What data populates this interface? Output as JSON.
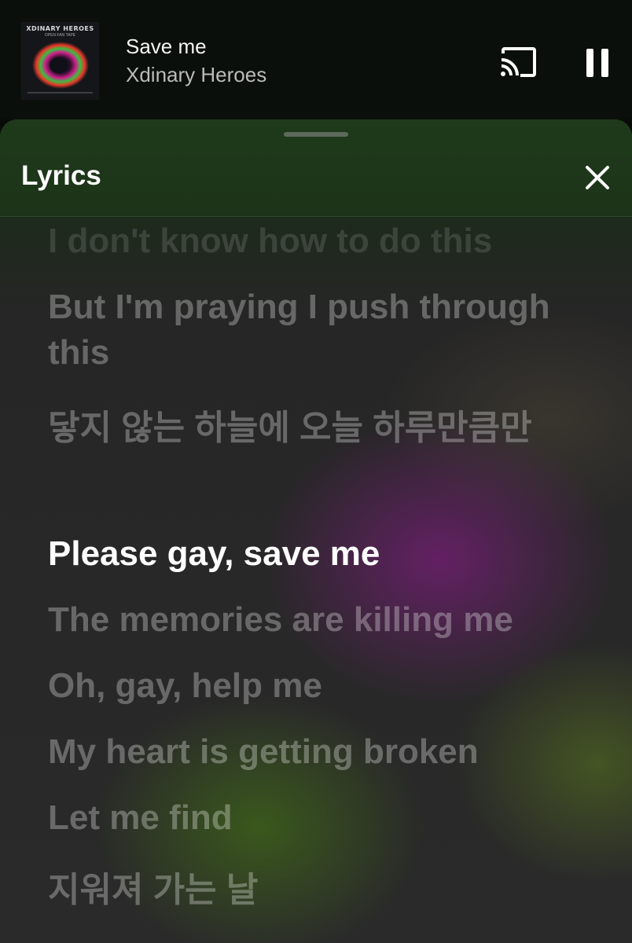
{
  "now_playing": {
    "album_art_title": "XDINARY HEROES",
    "album_art_subtitle": "OPEN FAN TAPE",
    "track_title": "Save me",
    "artist": "Xdinary Heroes",
    "cast_icon": "cast-icon",
    "pause_icon": "pause-icon"
  },
  "lyrics_sheet": {
    "title": "Lyrics",
    "close_icon": "close-icon",
    "lines": [
      {
        "text": "I don't know how to do this",
        "state": "faded"
      },
      {
        "text": "But I'm praying I push through this",
        "state": "inactive"
      },
      {
        "text": "닿지 않는 하늘에 오늘 하루만큼만",
        "state": "inactive"
      },
      {
        "text": "Please gay, save me",
        "state": "active"
      },
      {
        "text": "The memories are killing me",
        "state": "inactive"
      },
      {
        "text": "Oh, gay, help me",
        "state": "inactive"
      },
      {
        "text": "My heart is getting broken",
        "state": "inactive"
      },
      {
        "text": "Let me find",
        "state": "inactive"
      },
      {
        "text": "지워져 가는 날",
        "state": "inactive"
      }
    ]
  },
  "colors": {
    "header_green": "#1e3a1a",
    "active_lyric": "#ffffff",
    "inactive_lyric": "rgba(255,255,255,0.3)"
  }
}
